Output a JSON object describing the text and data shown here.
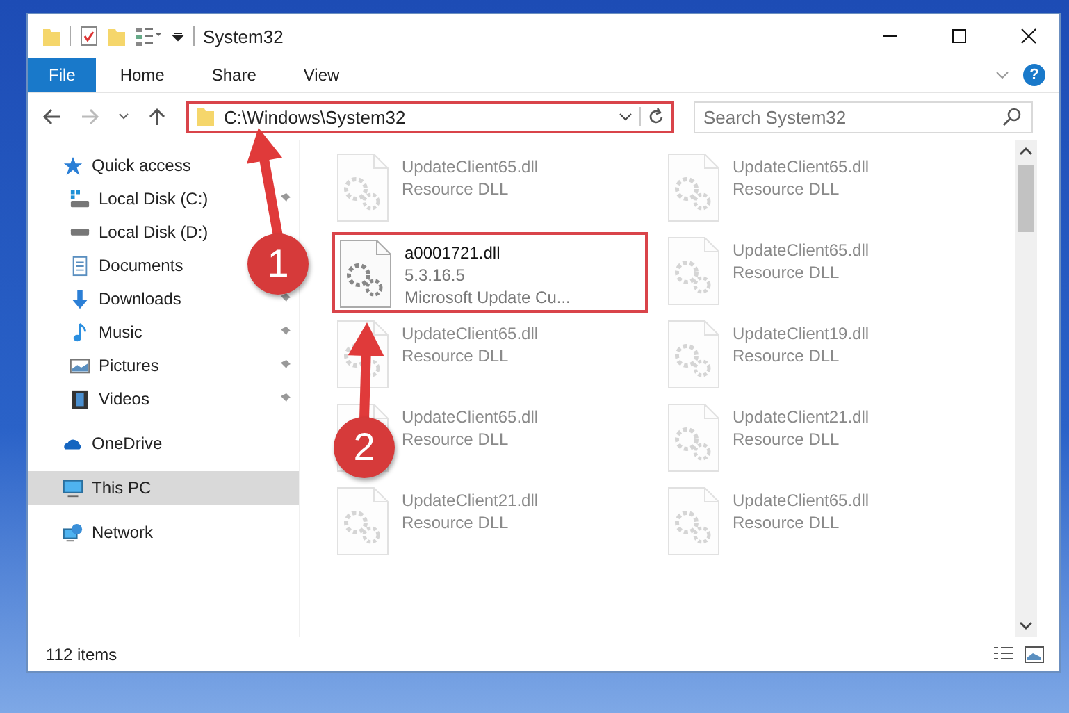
{
  "window": {
    "title": "System32"
  },
  "ribbon": {
    "tabs": [
      {
        "label": "File",
        "kind": "file"
      },
      {
        "label": "Home",
        "kind": "tab"
      },
      {
        "label": "Share",
        "kind": "tab"
      },
      {
        "label": "View",
        "kind": "tab"
      }
    ],
    "help": "?"
  },
  "address": {
    "path": "C:\\Windows\\System32",
    "highlighted": true
  },
  "search": {
    "placeholder": "Search System32"
  },
  "sidebar": {
    "items": [
      {
        "label": "Quick access",
        "kind": "star",
        "selected": false,
        "children": [
          {
            "label": "Local Disk (C:)",
            "kind": "disk-c",
            "pinned": true,
            "selected": false
          },
          {
            "label": "Local Disk (D:)",
            "kind": "disk",
            "pinned": false,
            "selected": false
          },
          {
            "label": "Documents",
            "kind": "doc",
            "pinned": false,
            "selected": false
          },
          {
            "label": "Downloads",
            "kind": "download",
            "pinned": true,
            "selected": false
          },
          {
            "label": "Music",
            "kind": "music",
            "pinned": true,
            "selected": false
          },
          {
            "label": "Pictures",
            "kind": "pictures",
            "pinned": true,
            "selected": false
          },
          {
            "label": "Videos",
            "kind": "videos",
            "pinned": true,
            "selected": false
          }
        ]
      },
      {
        "label": "OneDrive",
        "kind": "cloud",
        "selected": false
      },
      {
        "label": "This PC",
        "kind": "pc",
        "selected": true
      },
      {
        "label": "Network",
        "kind": "network",
        "selected": false
      }
    ]
  },
  "files": [
    {
      "name": "UpdateClient65.dll",
      "lines": [
        "Resource DLL"
      ],
      "faded": true,
      "highlighted": false
    },
    {
      "name": "UpdateClient65.dll",
      "lines": [
        "Resource DLL"
      ],
      "faded": true,
      "highlighted": false
    },
    {
      "name": "a0001721.dll",
      "lines": [
        "5.3.16.5",
        "Microsoft Update Cu..."
      ],
      "faded": false,
      "highlighted": true
    },
    {
      "name": "UpdateClient65.dll",
      "lines": [
        "Resource DLL"
      ],
      "faded": true,
      "highlighted": false
    },
    {
      "name": "UpdateClient65.dll",
      "lines": [
        "Resource DLL"
      ],
      "faded": true,
      "highlighted": false
    },
    {
      "name": "UpdateClient19.dll",
      "lines": [
        "Resource DLL"
      ],
      "faded": true,
      "highlighted": false
    },
    {
      "name": "UpdateClient65.dll",
      "lines": [
        "Resource DLL"
      ],
      "faded": true,
      "highlighted": false
    },
    {
      "name": "UpdateClient21.dll",
      "lines": [
        "Resource DLL"
      ],
      "faded": true,
      "highlighted": false
    },
    {
      "name": "UpdateClient21.dll",
      "lines": [
        "Resource DLL"
      ],
      "faded": true,
      "highlighted": false
    },
    {
      "name": "UpdateClient65.dll",
      "lines": [
        "Resource DLL"
      ],
      "faded": true,
      "highlighted": false
    }
  ],
  "status_bar": {
    "count": "112 items"
  },
  "annotations": [
    {
      "number": "1"
    },
    {
      "number": "2"
    }
  ]
}
